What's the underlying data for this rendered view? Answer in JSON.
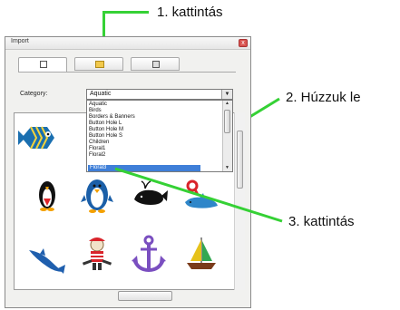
{
  "annotations": {
    "step1": "1. kattintás",
    "step2": "2. Húzzuk le",
    "step3": "3. kattintás"
  },
  "dialog": {
    "title": "Import",
    "close_glyph": "x",
    "category_label": "Category:",
    "category_value": "Aquatic",
    "dropdown_arrow": "▼",
    "category_options": [
      "Aquatic",
      "Birds",
      "Borders & Banners",
      "Button Hole L",
      "Button Hole M",
      "Button Hole S",
      "Children",
      "Floral1",
      "Floral2",
      "Floral3"
    ],
    "selected_option": "Floral3",
    "scroll_up": "▲",
    "scroll_down": "▼"
  },
  "thumbnails": [
    "fish",
    "penguin",
    "penguin-large",
    "whale",
    "dolphin-hat",
    "dolphin",
    "pirate-bear",
    "anchor",
    "sailboat"
  ],
  "colors": {
    "annotation_green": "#35d135",
    "selection_blue": "#3f7fd8"
  }
}
